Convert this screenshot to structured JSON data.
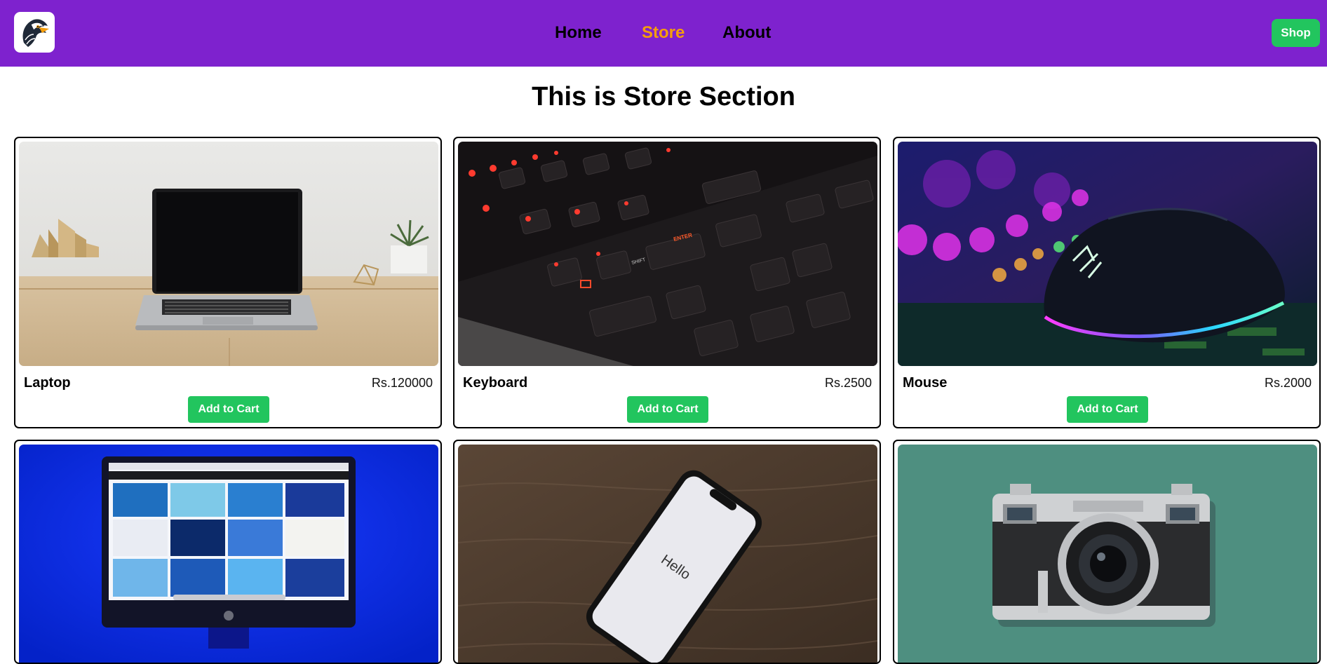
{
  "nav": {
    "logo_icon": "eagle-logo-icon",
    "links": [
      {
        "label": "Home",
        "active": false
      },
      {
        "label": "Store",
        "active": true
      },
      {
        "label": "About",
        "active": false
      }
    ],
    "shop_label": "Shop"
  },
  "page": {
    "title": "This is Store Section"
  },
  "products": [
    {
      "name": "Laptop",
      "price": "Rs.120000",
      "button": "Add to Cart"
    },
    {
      "name": "Keyboard",
      "price": "Rs.2500",
      "button": "Add to Cart"
    },
    {
      "name": "Mouse",
      "price": "Rs.2000",
      "button": "Add to Cart"
    },
    {
      "name": "",
      "price": "",
      "button": ""
    },
    {
      "name": "",
      "price": "",
      "button": ""
    },
    {
      "name": "",
      "price": "",
      "button": ""
    }
  ],
  "images": {
    "monitor_screen_text": "",
    "phone_screen_text": "Hello"
  },
  "colors": {
    "navbar": "#7e22ce",
    "active_link": "#f59e0b",
    "button": "#22c55e"
  }
}
